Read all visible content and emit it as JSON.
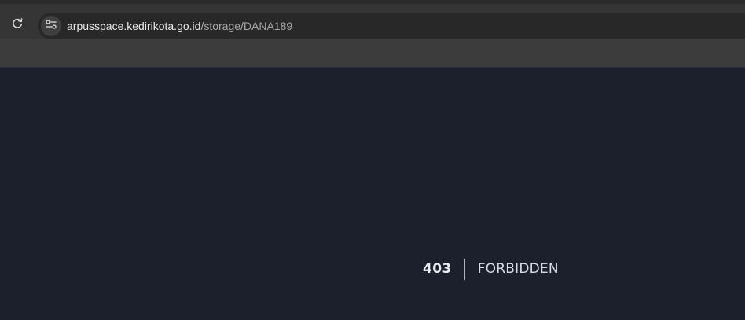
{
  "browser": {
    "url_host": "arpusspace.kedirikota.go.id",
    "url_path": "/storage/DANA189",
    "icons": {
      "reload": "reload-icon",
      "site_info": "site-info-icon"
    }
  },
  "error": {
    "code": "403",
    "message": "FORBIDDEN"
  },
  "colors": {
    "page_background": "#1b202c",
    "chrome_background": "#3c3c3c",
    "omnibox_background": "#282828",
    "text_primary": "#e9edf3"
  }
}
